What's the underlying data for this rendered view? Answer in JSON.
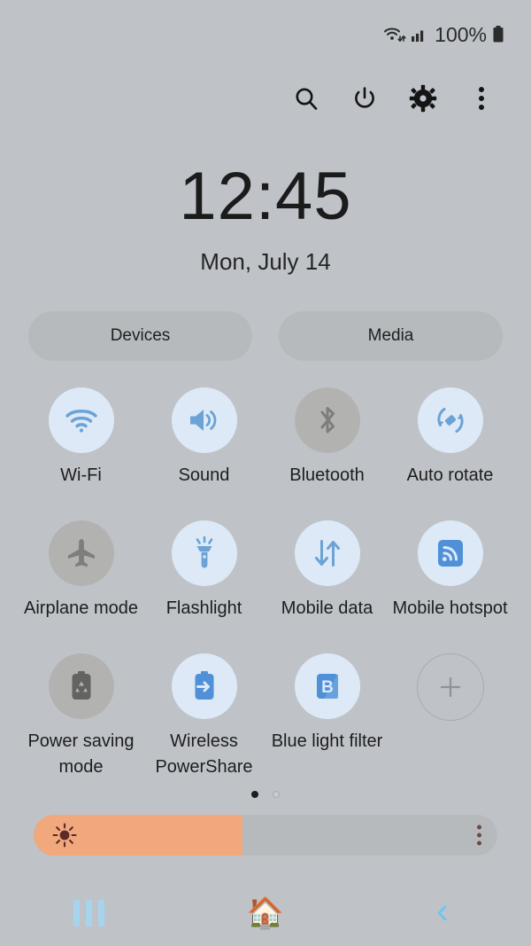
{
  "status_bar": {
    "wifi_icon": "wifi-with-transfer-icon",
    "signal_icon": "cellular-signal-icon",
    "battery_text": "100%",
    "battery_icon": "battery-full-icon"
  },
  "header": {
    "actions": [
      {
        "name": "search-icon",
        "label": "Search"
      },
      {
        "name": "power-icon",
        "label": "Power"
      },
      {
        "name": "settings-gear-icon",
        "label": "Settings"
      },
      {
        "name": "more-options-icon",
        "label": "More options"
      }
    ]
  },
  "clock": {
    "time": "12:45",
    "date": "Mon, July 14"
  },
  "pills": [
    {
      "label": "Devices"
    },
    {
      "label": "Media"
    }
  ],
  "toggles": [
    {
      "label": "Wi-Fi",
      "icon": "wifi-icon",
      "state": "on"
    },
    {
      "label": "Sound",
      "icon": "sound-speaker-icon",
      "state": "on"
    },
    {
      "label": "Bluetooth",
      "icon": "bluetooth-icon",
      "state": "off"
    },
    {
      "label": "Auto rotate",
      "icon": "auto-rotate-icon",
      "state": "on"
    },
    {
      "label": "Airplane mode",
      "icon": "airplane-icon",
      "state": "off"
    },
    {
      "label": "Flashlight",
      "icon": "flashlight-icon",
      "state": "on"
    },
    {
      "label": "Mobile data",
      "icon": "mobile-data-icon",
      "state": "on"
    },
    {
      "label": "Mobile hotspot",
      "icon": "mobile-hotspot-icon",
      "state": "on"
    },
    {
      "label": "Power saving mode",
      "icon": "power-saving-icon",
      "state": "off"
    },
    {
      "label": "Wireless PowerShare",
      "icon": "wireless-powershare-icon",
      "state": "on"
    },
    {
      "label": "Blue light filter",
      "icon": "blue-light-filter-icon",
      "state": "on"
    },
    {
      "label": "",
      "icon": "add-plus-icon",
      "state": "add"
    }
  ],
  "pagination": {
    "total": 2,
    "active_index": 0
  },
  "brightness": {
    "icon": "brightness-sun-icon",
    "value_percent": 45,
    "menu_icon": "brightness-more-options-icon"
  },
  "nav_bar": {
    "recents_label": "Recents",
    "recents_icon": "recents-bars-icon",
    "home_icon": "home-house-icon",
    "home_glyph": "🏠",
    "back_icon": "back-chevron-icon",
    "back_glyph": "‹"
  },
  "colors": {
    "background": "#bfc3c8",
    "toggle_on_bg": "#dde9f6",
    "toggle_on_fg": "#6ba3d6",
    "toggle_off_bg": "#b2b3b0",
    "toggle_off_fg": "#7e7e7c",
    "pill_bg": "#b7babd",
    "brightness_fill": "#f0a87c",
    "nav_accent": "#8ccdf0"
  }
}
